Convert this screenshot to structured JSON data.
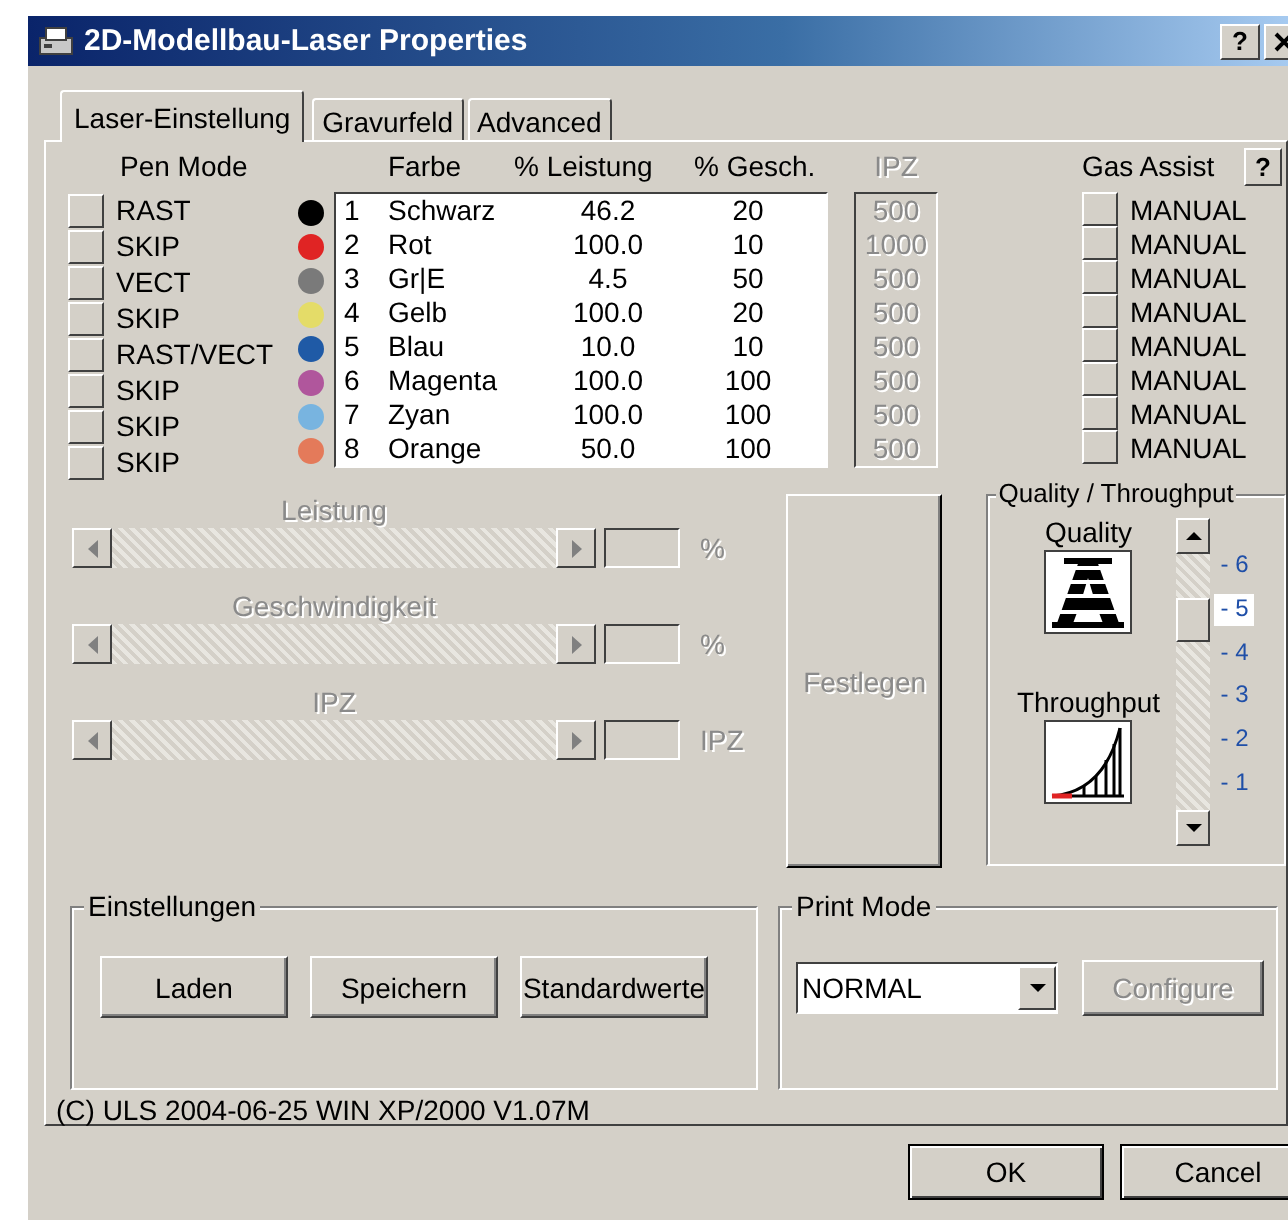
{
  "window": {
    "title": "2D-Modellbau-Laser Properties",
    "help": "?"
  },
  "tabs": [
    {
      "label": "Laser-Einstellung",
      "selected": true
    },
    {
      "label": "Gravurfeld",
      "selected": false
    },
    {
      "label": "Advanced",
      "selected": false
    }
  ],
  "pen_mode": {
    "label": "Pen Mode",
    "items": [
      "RAST",
      "SKIP",
      "VECT",
      "SKIP",
      "RAST/VECT",
      "SKIP",
      "SKIP",
      "SKIP"
    ]
  },
  "pen_table": {
    "columns": [
      "Farbe",
      "% Leistung",
      "% Gesch."
    ],
    "rows": [
      {
        "number": "1",
        "name": "Schwarz",
        "color": "#000000",
        "power": "46.2",
        "speed": "20"
      },
      {
        "number": "2",
        "name": "Rot",
        "color": "#e02424",
        "power": "100.0",
        "speed": "10"
      },
      {
        "number": "3",
        "name": "Gr|E",
        "color": "#7a7a7a",
        "power": "4.5",
        "speed": "50"
      },
      {
        "number": "4",
        "name": "Gelb",
        "color": "#e4dc68",
        "power": "100.0",
        "speed": "20"
      },
      {
        "number": "5",
        "name": "Blau",
        "color": "#1f5aa6",
        "power": "10.0",
        "speed": "10"
      },
      {
        "number": "6",
        "name": "Magenta",
        "color": "#b0569c",
        "power": "100.0",
        "speed": "100"
      },
      {
        "number": "7",
        "name": "Zyan",
        "color": "#78b4e0",
        "power": "100.0",
        "speed": "100"
      },
      {
        "number": "8",
        "name": "Orange",
        "color": "#e47a5a",
        "power": "50.0",
        "speed": "100"
      }
    ]
  },
  "ipz": {
    "label": "IPZ",
    "disabled": true,
    "values": [
      "500",
      "1000",
      "500",
      "500",
      "500",
      "500",
      "500",
      "500"
    ]
  },
  "gas_assist": {
    "label": "Gas Assist",
    "help": "?",
    "items": [
      "MANUAL",
      "MANUAL",
      "MANUAL",
      "MANUAL",
      "MANUAL",
      "MANUAL",
      "MANUAL",
      "MANUAL"
    ]
  },
  "sliders": [
    {
      "label": "Leistung",
      "unit": "%",
      "disabled": true
    },
    {
      "label": "Geschwindigkeit",
      "unit": "%",
      "disabled": true
    },
    {
      "label": "IPZ",
      "unit": "IPZ",
      "disabled": true
    }
  ],
  "apply_button": {
    "label": "Festlegen",
    "disabled": true
  },
  "quality_throughput": {
    "title": "Quality / Throughput",
    "quality_label": "Quality",
    "throughput_label": "Throughput",
    "ticks": [
      {
        "label": "- 6",
        "selected": false
      },
      {
        "label": "- 5",
        "selected": true
      },
      {
        "label": "- 4",
        "selected": false
      },
      {
        "label": "- 3",
        "selected": false
      },
      {
        "label": "- 2",
        "selected": false
      },
      {
        "label": "- 1",
        "selected": false
      }
    ]
  },
  "settings": {
    "title": "Einstellungen",
    "buttons": [
      "Laden",
      "Speichern",
      "Standardwerte"
    ]
  },
  "print_mode": {
    "title": "Print Mode",
    "value": "NORMAL",
    "configure": {
      "label": "Configure",
      "disabled": true
    }
  },
  "footer": "(C) ULS 2004-06-25 WIN XP/2000 V1.07M",
  "buttons": [
    "OK",
    "Cancel"
  ]
}
